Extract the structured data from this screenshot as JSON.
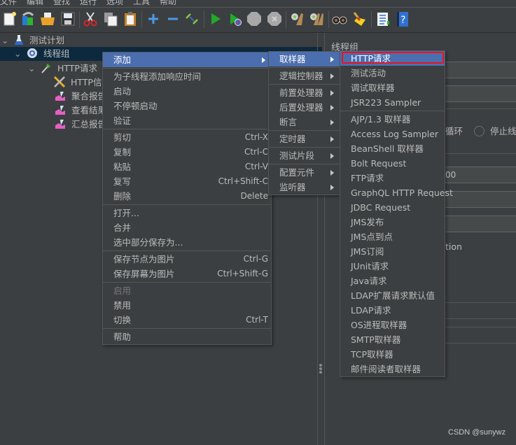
{
  "menubar": [
    "文件",
    "编辑",
    "查找",
    "运行",
    "选项",
    "工具",
    "帮助"
  ],
  "toolbar": {
    "icons": [
      "new-icon",
      "templates-icon",
      "open-icon",
      "save-icon",
      "cut-icon",
      "copy-icon",
      "paste-icon",
      "expand-icon",
      "collapse-icon",
      "toggle-icon",
      "start-icon",
      "start-no-pause-icon",
      "stop-icon",
      "shutdown-icon",
      "clear-icon",
      "clear-all-icon",
      "search-icon",
      "reset-search-icon",
      "function-helper-icon",
      "help-icon"
    ]
  },
  "tree": {
    "items": [
      {
        "label": "测试计划",
        "icon": "test-plan-icon"
      },
      {
        "label": "线程组",
        "icon": "thread-group-icon"
      },
      {
        "label": "HTTP请求",
        "icon": "http-sampler-icon"
      },
      {
        "label": "HTTP信息头管理器",
        "icon": "header-manager-icon"
      },
      {
        "label": "聚合报告",
        "icon": "listener-icon"
      },
      {
        "label": "查看结果树",
        "icon": "listener-icon"
      },
      {
        "label": "汇总报告",
        "icon": "listener-icon"
      }
    ]
  },
  "right_panel": {
    "title": "线程组",
    "radio_partial_1": "循环",
    "radio_partial_2": "停止线程",
    "field_value_partial": "00",
    "text_partial": "tion"
  },
  "context_menu": {
    "items": [
      {
        "label": "添加",
        "submenu": true,
        "highlighted": true
      },
      {
        "sep": true
      },
      {
        "label": "为子线程添加响应时间"
      },
      {
        "label": "启动"
      },
      {
        "label": "不停顿启动"
      },
      {
        "label": "验证"
      },
      {
        "sep": true
      },
      {
        "label": "剪切",
        "shortcut": "Ctrl-X"
      },
      {
        "label": "复制",
        "shortcut": "Ctrl-C"
      },
      {
        "label": "粘贴",
        "shortcut": "Ctrl-V"
      },
      {
        "label": "复写",
        "shortcut": "Ctrl+Shift-C"
      },
      {
        "label": "删除",
        "shortcut": "Delete"
      },
      {
        "sep": true
      },
      {
        "label": "打开..."
      },
      {
        "label": "合并"
      },
      {
        "label": "选中部分保存为..."
      },
      {
        "sep": true
      },
      {
        "label": "保存节点为图片",
        "shortcut": "Ctrl-G"
      },
      {
        "label": "保存屏幕为图片",
        "shortcut": "Ctrl+Shift-G"
      },
      {
        "sep": true
      },
      {
        "label": "启用",
        "disabled": true
      },
      {
        "label": "禁用"
      },
      {
        "label": "切换",
        "shortcut": "Ctrl-T"
      },
      {
        "sep": true
      },
      {
        "label": "帮助"
      }
    ]
  },
  "add_submenu": {
    "items": [
      {
        "label": "取样器",
        "submenu": true,
        "highlighted": true
      },
      {
        "sep": true
      },
      {
        "label": "逻辑控制器",
        "submenu": true
      },
      {
        "sep": true
      },
      {
        "label": "前置处理器",
        "submenu": true
      },
      {
        "label": "后置处理器",
        "submenu": true
      },
      {
        "label": "断言",
        "submenu": true
      },
      {
        "sep": true
      },
      {
        "label": "定时器",
        "submenu": true
      },
      {
        "sep": true
      },
      {
        "label": "测试片段",
        "submenu": true
      },
      {
        "sep": true
      },
      {
        "label": "配置元件",
        "submenu": true
      },
      {
        "label": "监听器",
        "submenu": true
      }
    ]
  },
  "sampler_submenu": {
    "items": [
      {
        "label": "HTTP请求",
        "highlighted": true,
        "annotated": true
      },
      {
        "label": "测试活动"
      },
      {
        "label": "调试取样器"
      },
      {
        "label": "JSR223 Sampler"
      },
      {
        "sep": true
      },
      {
        "label": "AJP/1.3 取样器"
      },
      {
        "label": "Access Log Sampler"
      },
      {
        "label": "BeanShell 取样器"
      },
      {
        "label": "Bolt Request"
      },
      {
        "label": "FTP请求"
      },
      {
        "label": "GraphQL HTTP Request"
      },
      {
        "label": "JDBC Request"
      },
      {
        "label": "JMS发布"
      },
      {
        "label": "JMS点到点"
      },
      {
        "label": "JMS订阅"
      },
      {
        "label": "JUnit请求"
      },
      {
        "label": "Java请求"
      },
      {
        "label": "LDAP扩展请求默认值"
      },
      {
        "label": "LDAP请求"
      },
      {
        "label": "OS进程取样器"
      },
      {
        "label": "SMTP取样器"
      },
      {
        "label": "TCP取样器"
      },
      {
        "label": "邮件阅读者取样器"
      }
    ]
  },
  "watermark": "CSDN @sunywz",
  "colors": {
    "background": "#3c3f41",
    "highlight": "#4b6eaf",
    "selection": "#0d293e",
    "annotation": "#e8141c"
  }
}
